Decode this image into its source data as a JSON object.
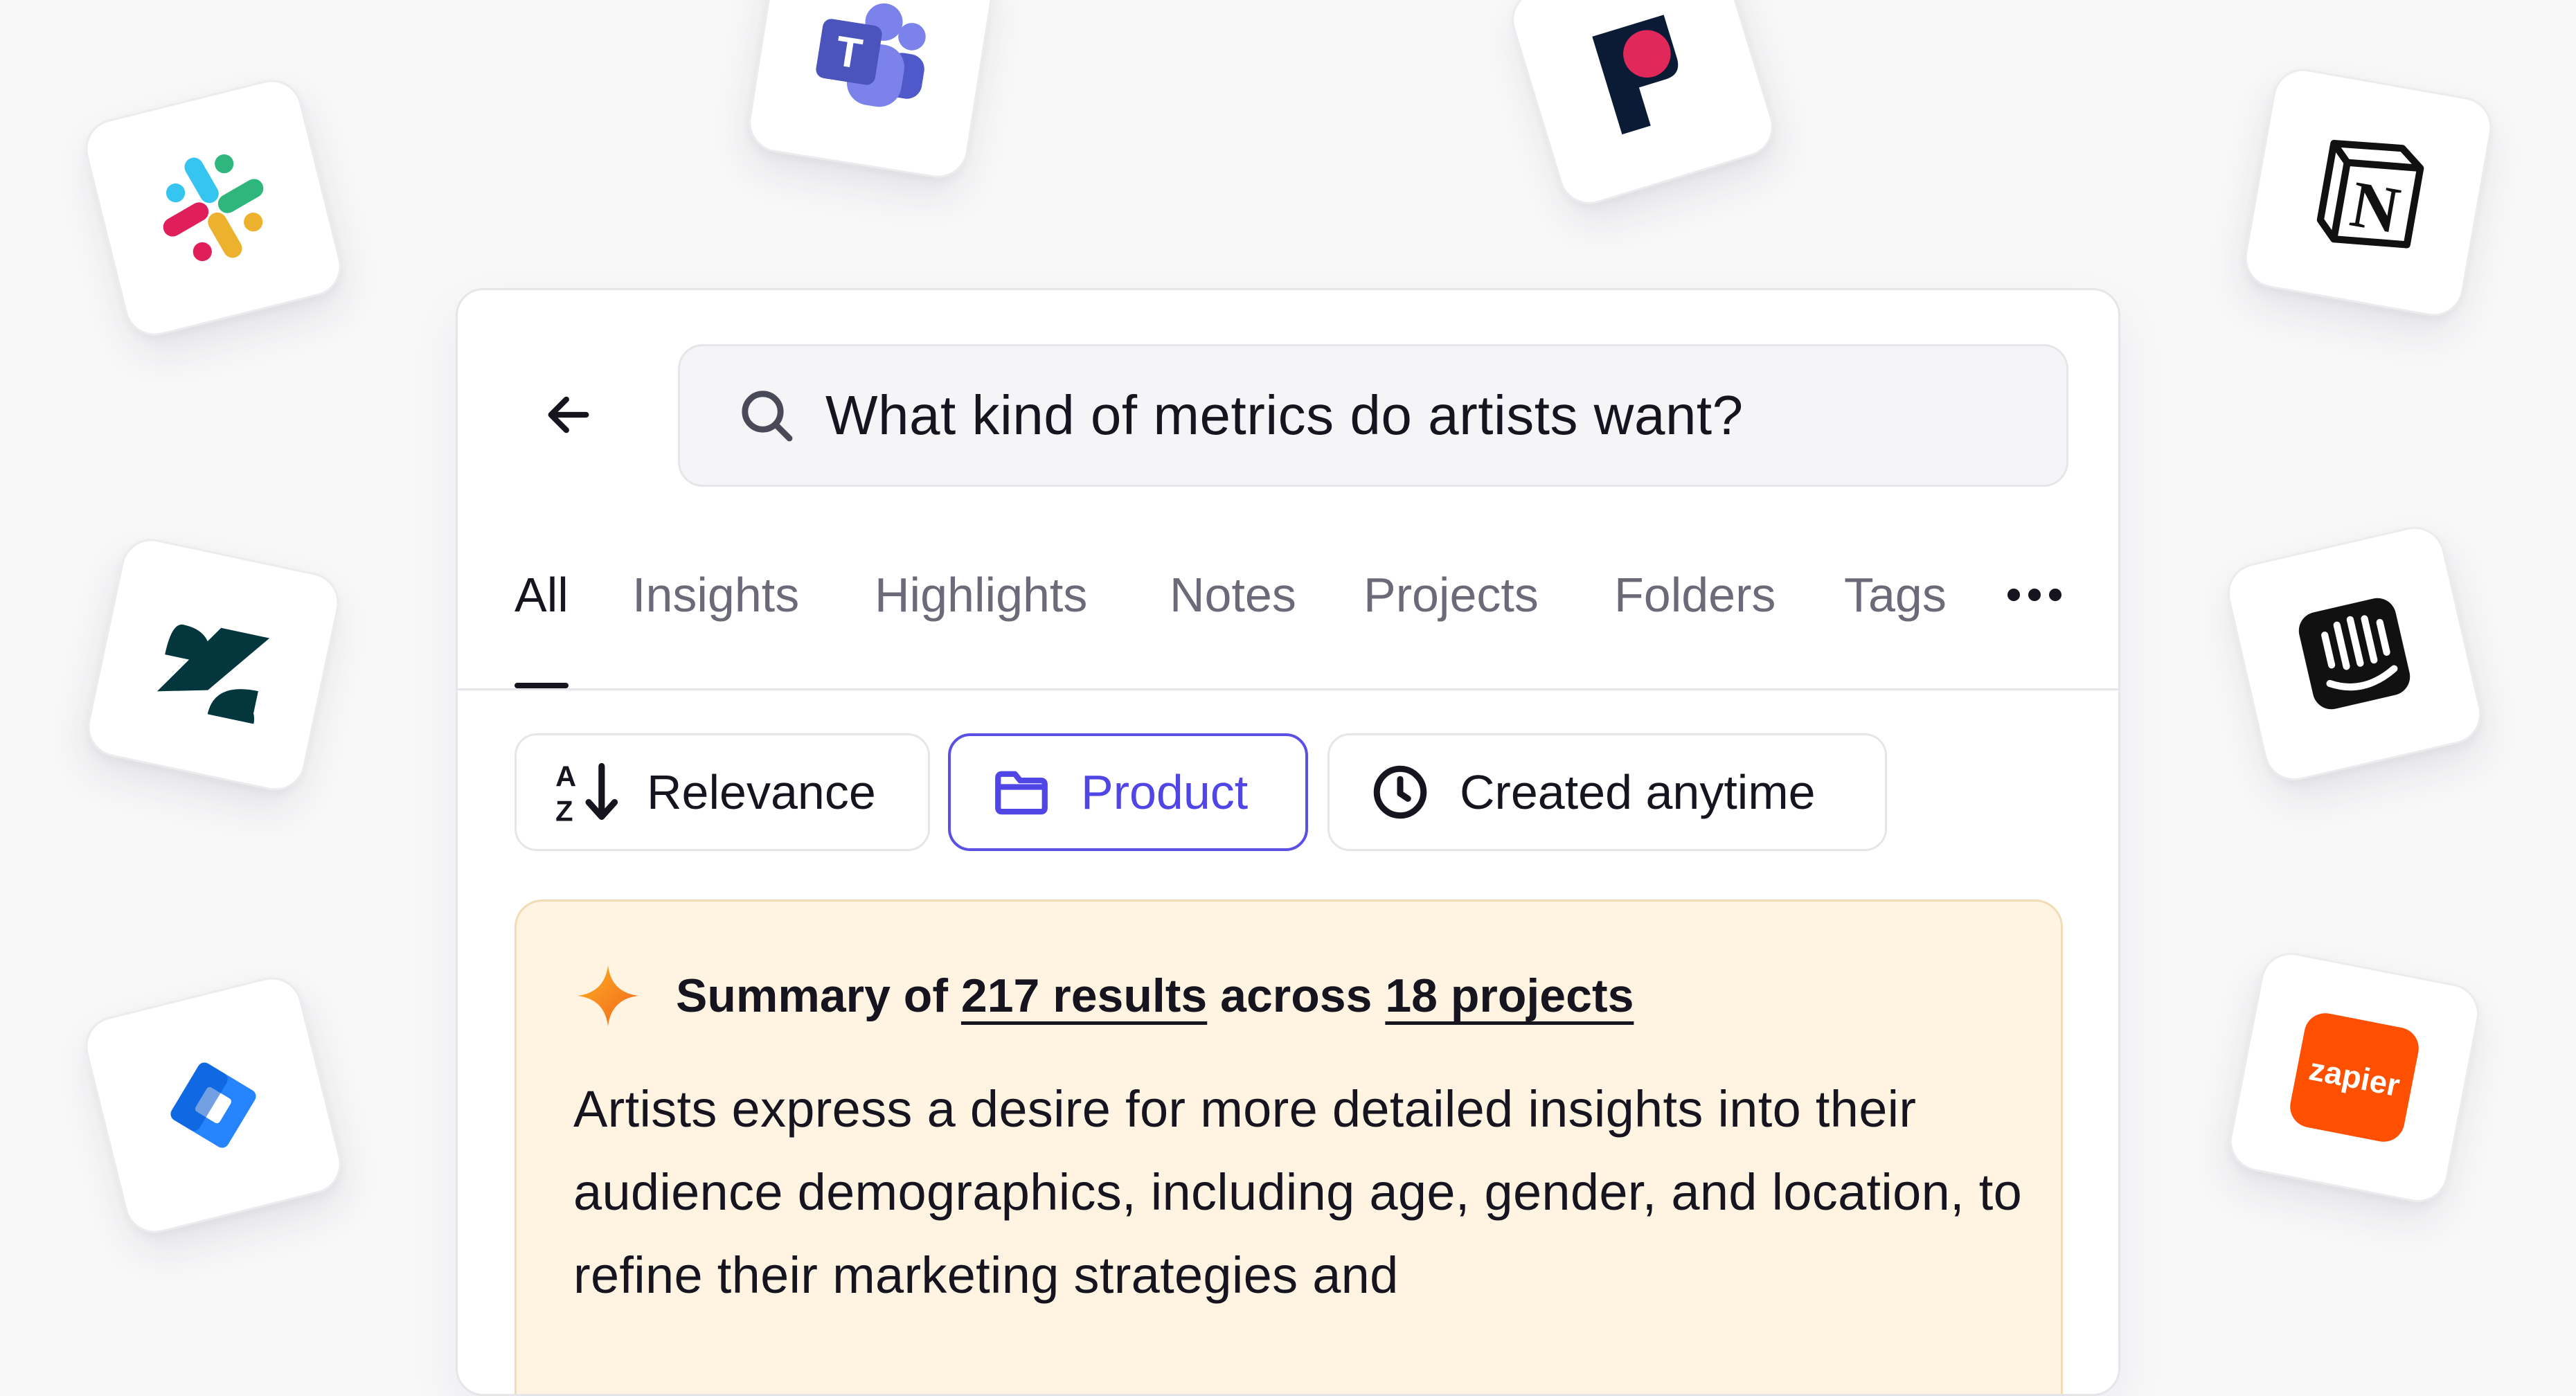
{
  "integrations": [
    {
      "name": "Slack",
      "icon": "slack-icon"
    },
    {
      "name": "Microsoft Teams",
      "icon": "teams-icon"
    },
    {
      "name": "Pendo",
      "icon": "pendo-icon"
    },
    {
      "name": "Notion",
      "icon": "notion-icon"
    },
    {
      "name": "Zendesk",
      "icon": "zendesk-icon"
    },
    {
      "name": "Intercom",
      "icon": "intercom-icon"
    },
    {
      "name": "Jira",
      "icon": "jira-icon"
    },
    {
      "name": "Zapier",
      "icon": "zapier-icon",
      "label": "zapier"
    }
  ],
  "search": {
    "back_icon": "arrow-left-icon",
    "icon": "search-icon",
    "query": "What kind of metrics do artists want?"
  },
  "tabs": [
    {
      "label": "All",
      "active": true
    },
    {
      "label": "Insights"
    },
    {
      "label": "Highlights"
    },
    {
      "label": "Notes"
    },
    {
      "label": "Projects"
    },
    {
      "label": "Folders"
    },
    {
      "label": "Tags"
    }
  ],
  "tabs_more_icon": "more-horizontal-icon",
  "filters": {
    "sort": {
      "label": "Relevance",
      "icon": "sort-az-icon"
    },
    "folder": {
      "label": "Product",
      "icon": "folder-icon",
      "selected": true
    },
    "date": {
      "label": "Created anytime",
      "icon": "clock-icon"
    }
  },
  "summary": {
    "icon": "sparkle-icon",
    "prefix": "Summary of",
    "results_link": "217 results",
    "middle": "across",
    "projects_link": "18 projects",
    "text": "Artists express a desire for more detailed insights into their audience demographics, including age, gender, and location, to refine their marketing strategies and"
  },
  "colors": {
    "accent": "#4f46e5",
    "summary_bg": "#fff4e2",
    "summary_border": "#f2dcb4",
    "page_bg": "#f8f8f9"
  }
}
